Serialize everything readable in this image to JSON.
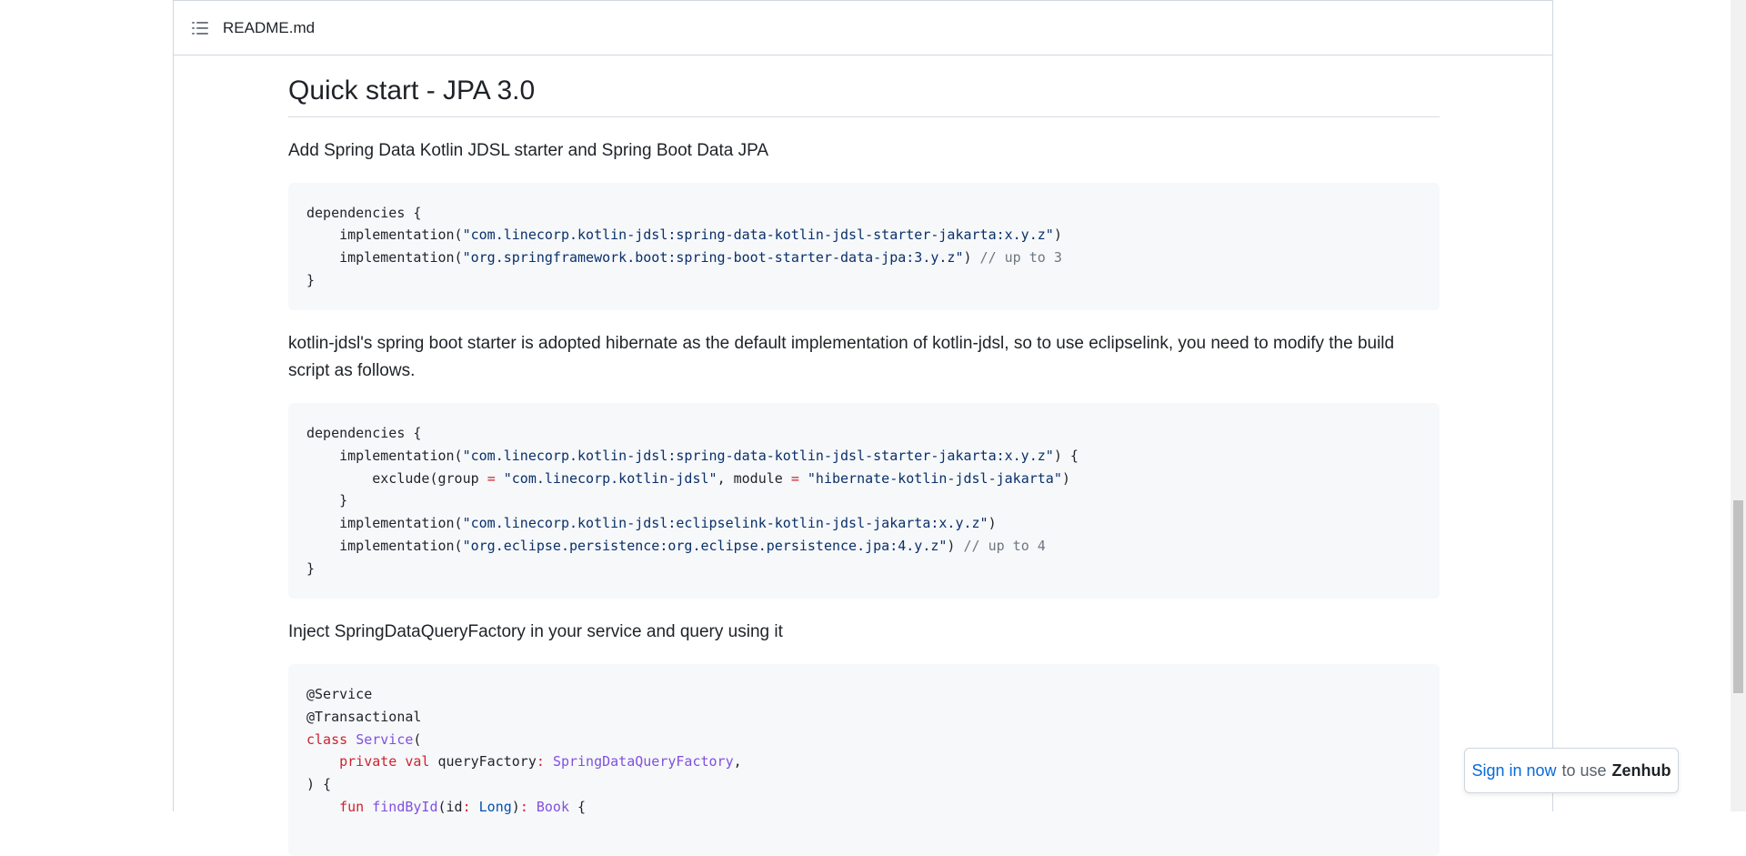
{
  "file_header": {
    "title": "README.md"
  },
  "content": {
    "heading": "Quick start - JPA 3.0",
    "para1": "Add Spring Data Kotlin JDSL starter and Spring Boot Data JPA",
    "code1": [
      [
        {
          "t": "dependencies {"
        }
      ],
      [
        {
          "t": "    implementation("
        },
        {
          "t": "\"com.linecorp.kotlin-jdsl:spring-data-kotlin-jdsl-starter-jakarta:x.y.z\"",
          "c": "s"
        },
        {
          "t": ")"
        }
      ],
      [
        {
          "t": "    implementation("
        },
        {
          "t": "\"org.springframework.boot:spring-boot-starter-data-jpa:3.y.z\"",
          "c": "s"
        },
        {
          "t": ") "
        },
        {
          "t": "// up to 3",
          "c": "c"
        }
      ],
      [
        {
          "t": "}"
        }
      ]
    ],
    "para2": "kotlin-jdsl's spring boot starter is adopted hibernate as the default implementation of kotlin-jdsl, so to use eclipselink, you need to modify the build script as follows.",
    "code2": [
      [
        {
          "t": "dependencies {"
        }
      ],
      [
        {
          "t": "    implementation("
        },
        {
          "t": "\"com.linecorp.kotlin-jdsl:spring-data-kotlin-jdsl-starter-jakarta:x.y.z\"",
          "c": "s"
        },
        {
          "t": ") {"
        }
      ],
      [
        {
          "t": "        exclude(group "
        },
        {
          "t": "=",
          "c": "k"
        },
        {
          "t": " "
        },
        {
          "t": "\"com.linecorp.kotlin-jdsl\"",
          "c": "s"
        },
        {
          "t": ", module "
        },
        {
          "t": "=",
          "c": "k"
        },
        {
          "t": " "
        },
        {
          "t": "\"hibernate-kotlin-jdsl-jakarta\"",
          "c": "s"
        },
        {
          "t": ")"
        }
      ],
      [
        {
          "t": "    }"
        }
      ],
      [
        {
          "t": "    implementation("
        },
        {
          "t": "\"com.linecorp.kotlin-jdsl:eclipselink-kotlin-jdsl-jakarta:x.y.z\"",
          "c": "s"
        },
        {
          "t": ")"
        }
      ],
      [
        {
          "t": "    implementation("
        },
        {
          "t": "\"org.eclipse.persistence:org.eclipse.persistence.jpa:4.y.z\"",
          "c": "s"
        },
        {
          "t": ") "
        },
        {
          "t": "// up to 4",
          "c": "c"
        }
      ],
      [
        {
          "t": "}"
        }
      ]
    ],
    "para3": "Inject SpringDataQueryFactory in your service and query using it",
    "code3": [
      [
        {
          "t": "@Service"
        }
      ],
      [
        {
          "t": "@Transactional"
        }
      ],
      [
        {
          "t": "class",
          "c": "k"
        },
        {
          "t": " "
        },
        {
          "t": "Service",
          "c": "t"
        },
        {
          "t": "("
        }
      ],
      [
        {
          "t": "    "
        },
        {
          "t": "private",
          "c": "k"
        },
        {
          "t": " "
        },
        {
          "t": "val",
          "c": "k"
        },
        {
          "t": " queryFactory"
        },
        {
          "t": ":",
          "c": "k"
        },
        {
          "t": " "
        },
        {
          "t": "SpringDataQueryFactory",
          "c": "t"
        },
        {
          "t": ","
        }
      ],
      [
        {
          "t": ") {"
        }
      ],
      [
        {
          "t": "    "
        },
        {
          "t": "fun",
          "c": "k"
        },
        {
          "t": " "
        },
        {
          "t": "findById",
          "c": "t"
        },
        {
          "t": "(id"
        },
        {
          "t": ":",
          "c": "k"
        },
        {
          "t": " "
        },
        {
          "t": "Long",
          "c": "n"
        },
        {
          "t": ")"
        },
        {
          "t": ":",
          "c": "k"
        },
        {
          "t": " "
        },
        {
          "t": "Book",
          "c": "t"
        },
        {
          "t": " {"
        }
      ]
    ]
  },
  "zenhub": {
    "link": "Sign in now",
    "mid": "to use",
    "brand": "Zenhub"
  },
  "colors": {
    "string": "#0a3069",
    "comment": "#6e7781",
    "keyword": "#cf222e",
    "type": "#8250df",
    "link": "#0969da"
  },
  "icons": {
    "toc": "list-unordered-icon"
  }
}
